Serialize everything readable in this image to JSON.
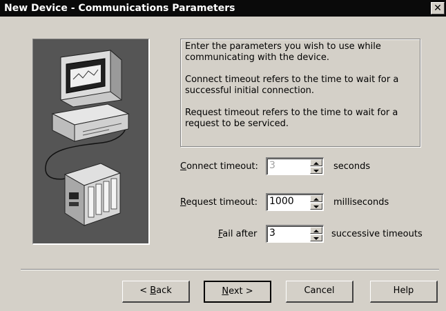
{
  "window": {
    "title": "New Device - Communications Parameters",
    "close_glyph": "✕"
  },
  "info": {
    "paragraph1": "Enter the parameters you wish to use while communicating with the device.",
    "paragraph2": "Connect timeout refers to the time to wait for a successful initial connection.",
    "paragraph3": "Request timeout refers to the time to wait for a request to be serviced."
  },
  "fields": {
    "connect": {
      "label_key": "C",
      "label_rest": "onnect timeout:",
      "value": "3",
      "suffix": "seconds"
    },
    "request": {
      "label_key": "R",
      "label_rest": "equest timeout:",
      "value": "1000",
      "suffix": "milliseconds"
    },
    "fail": {
      "label_key": "F",
      "label_rest": "ail after",
      "value": "3",
      "suffix": "successive timeouts"
    }
  },
  "buttons": {
    "back_pre": "< ",
    "back_key": "B",
    "back_rest": "ack",
    "next_key": "N",
    "next_rest": "ext >",
    "cancel": "Cancel",
    "help": "Help"
  },
  "icons": {
    "illustration": "computer-connected-to-device",
    "spin_up": "spin-up-arrow",
    "spin_down": "spin-down-arrow"
  }
}
